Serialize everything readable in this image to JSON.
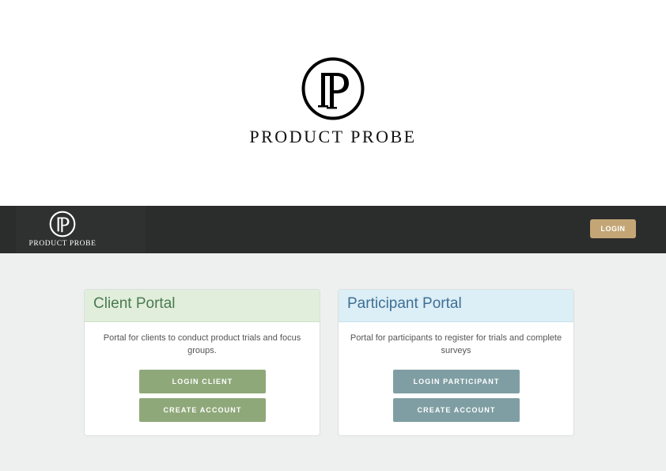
{
  "brand": {
    "name": "PRODUCT PROBE",
    "logo_icon": "pp-monogram-logo"
  },
  "navbar": {
    "brand_name": "PRODUCT PROBE",
    "login_label": "LOGIN",
    "login_color": "#c4a676"
  },
  "cards": {
    "client": {
      "title": "Client Portal",
      "description": "Portal for clients to conduct product trials and focus groups.",
      "primary_label": "LOGIN CLIENT",
      "secondary_label": "CREATE ACCOUNT",
      "accent": "#8fa87a"
    },
    "participant": {
      "title": "Participant Portal",
      "description": "Portal for participants to register for trials and complete surveys",
      "primary_label": "LOGIN PARTICIPANT",
      "secondary_label": "CREATE ACCOUNT",
      "accent": "#7f9ea3"
    }
  }
}
